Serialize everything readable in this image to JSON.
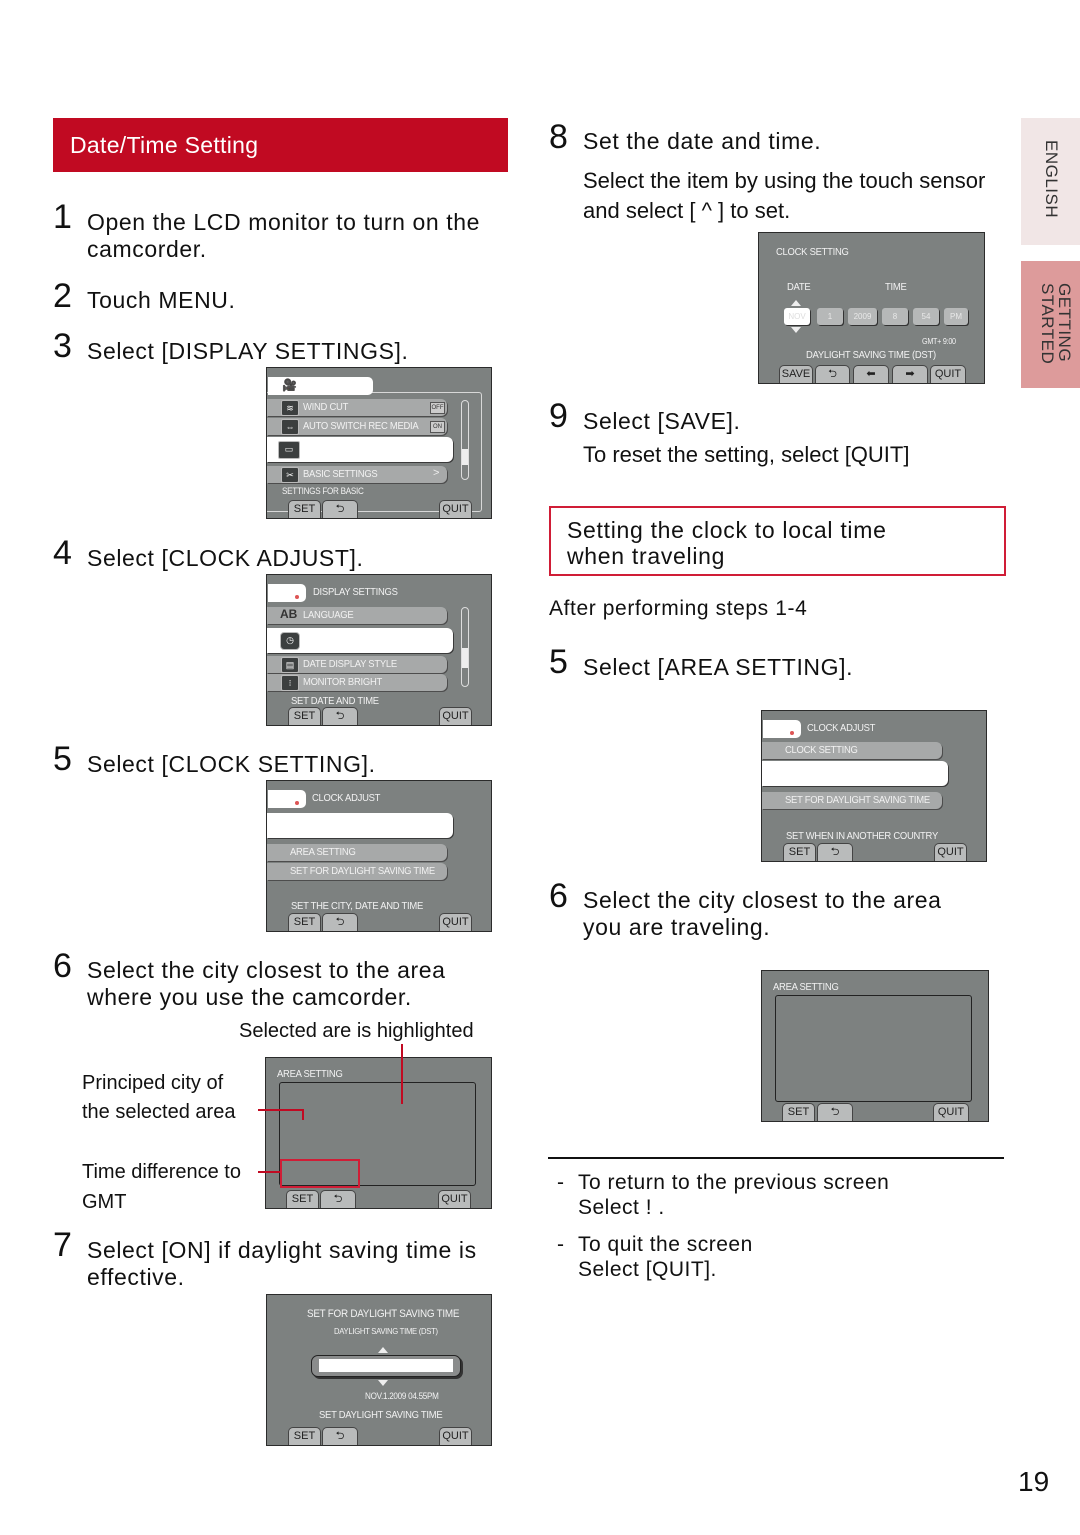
{
  "section_title": "Date/Time Setting",
  "side_tabs": {
    "english": "ENGLISH",
    "getting_started": "GETTING STARTED"
  },
  "page_number": "19",
  "colors": {
    "accent_red": "#c10a22",
    "tab_light": "#f1e6e6",
    "tab_pink": "#dd9b9b",
    "lcd_gray": "#7d8180"
  },
  "left_steps": [
    {
      "num": "1",
      "text": "Open the LCD monitor to turn on the camcorder."
    },
    {
      "num": "2",
      "text": "Touch MENU."
    },
    {
      "num": "3",
      "text": "Select [DISPLAY SETTINGS]."
    },
    {
      "num": "4",
      "text": "Select [CLOCK ADJUST]."
    },
    {
      "num": "5",
      "text": "Select [CLOCK SETTING]."
    },
    {
      "num": "6",
      "text": "Select the city closest to the area where you use the camcorder."
    },
    {
      "num": "7",
      "text": "Select [ON] if daylight saving time is effective."
    }
  ],
  "screens": {
    "menu": {
      "items": [
        "WIND CUT",
        "AUTO SWITCH REC MEDIA",
        "BASIC SETTINGS"
      ],
      "badges": [
        "OFF",
        "ON"
      ],
      "hint": "SETTINGS FOR BASIC",
      "set": "SET",
      "quit": "QUIT"
    },
    "display_settings": {
      "title": "DISPLAY SETTINGS",
      "items": [
        "LANGUAGE",
        "DATE DISPLAY STYLE",
        "MONITOR BRIGHT"
      ],
      "hint": "SET DATE AND TIME",
      "set": "SET",
      "quit": "QUIT"
    },
    "clock_adjust_1": {
      "title": "CLOCK ADJUST",
      "items": [
        "AREA SETTING",
        "SET FOR DAYLIGHT SAVING TIME"
      ],
      "hint": "SET THE CITY, DATE AND TIME",
      "set": "SET",
      "quit": "QUIT"
    },
    "area_setting_1": {
      "title": "AREA SETTING",
      "set": "SET",
      "quit": "QUIT",
      "callouts": {
        "highlighted": "Selected are is highlighted",
        "city_line1": "Principed city of",
        "city_line2": "the selected area",
        "gmt_line1": "Time difference to",
        "gmt_line2": "GMT"
      }
    },
    "dst": {
      "title": "SET FOR DAYLIGHT SAVING TIME",
      "subtitle": "DAYLIGHT SAVING TIME (DST)",
      "datetime": "NOV.1.2009 04.55PM",
      "hint": "SET DAYLIGHT SAVING TIME",
      "set": "SET",
      "quit": "QUIT"
    },
    "clock_setting": {
      "title": "CLOCK SETTING",
      "date_label": "DATE",
      "time_label": "TIME",
      "fields": [
        "NOV",
        "1",
        "2009",
        "8",
        "54",
        "PM"
      ],
      "gmt": "GMT+   9:00",
      "dst_label": "DAYLIGHT SAVING TIME (DST)",
      "save": "SAVE",
      "quit": "QUIT"
    },
    "clock_adjust_2": {
      "title": "CLOCK ADJUST",
      "items": [
        "CLOCK SETTING",
        "SET FOR DAYLIGHT SAVING TIME"
      ],
      "hint": "SET WHEN IN ANOTHER COUNTRY",
      "set": "SET",
      "quit": "QUIT"
    },
    "area_setting_2": {
      "title": "AREA SETTING",
      "set": "SET",
      "quit": "QUIT"
    }
  },
  "right_steps": {
    "step8": {
      "num": "8",
      "text": "Set the date and time.",
      "sub1": "Select the item by using the touch sensor",
      "sub2": "and select [ ^ ] to set."
    },
    "step9": {
      "num": "9",
      "text": "Select [SAVE].",
      "sub": "To reset the setting, select [QUIT]"
    },
    "travel_title_1": "Setting the clock to local time",
    "travel_title_2": "when traveling",
    "after_steps": "After performing steps 1-4",
    "step5": {
      "num": "5",
      "text": "Select [AREA SETTING]."
    },
    "step6": {
      "num": "6",
      "line1": "Select the city closest to the area",
      "line2": "you are traveling."
    }
  },
  "notes": [
    {
      "dash": "-",
      "line1": "To return to the previous screen",
      "line2": "Select  !  ."
    },
    {
      "dash": "-",
      "line1": "To quit the screen",
      "line2": "Select [QUIT]."
    }
  ]
}
